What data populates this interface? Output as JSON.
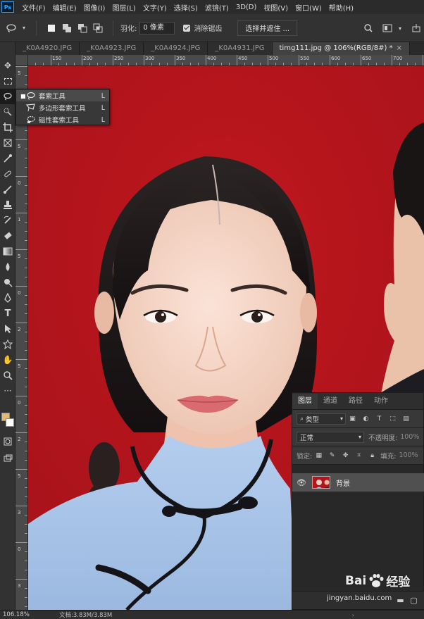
{
  "app": {
    "logo_text": "Ps"
  },
  "menubar": {
    "items": [
      "文件(F)",
      "编辑(E)",
      "图像(I)",
      "图层(L)",
      "文字(Y)",
      "选择(S)",
      "滤镜(T)",
      "3D(D)",
      "视图(V)",
      "窗口(W)",
      "帮助(H)"
    ]
  },
  "options": {
    "feather_label": "羽化:",
    "feather_value": "0 像素",
    "antialias_label": "消除锯齿",
    "select_mask_label": "选择并遮住 ..."
  },
  "tabs": [
    {
      "label": "_K0A4920.JPG",
      "active": false
    },
    {
      "label": "_K0A4923.JPG",
      "active": false
    },
    {
      "label": "_K0A4924.JPG",
      "active": false
    },
    {
      "label": "_K0A4931.JPG",
      "active": false
    },
    {
      "label": "timg111.jpg @ 106%(RGB/8#) *",
      "active": true
    }
  ],
  "ruler": {
    "h_labels": [
      "150",
      "200",
      "250",
      "300",
      "350",
      "400",
      "450",
      "500",
      "550",
      "600",
      "650",
      "700",
      "750"
    ],
    "v_labels": [
      "5",
      "0",
      "5",
      "0",
      "1",
      "5",
      "0",
      "2",
      "5",
      "0",
      "2",
      "5",
      "3",
      "0",
      "3"
    ]
  },
  "flyout": {
    "items": [
      {
        "label": "套索工具",
        "key": "L",
        "selected": true
      },
      {
        "label": "多边形套索工具",
        "key": "L",
        "selected": false
      },
      {
        "label": "磁性套索工具",
        "key": "L",
        "selected": false
      }
    ]
  },
  "layers_panel": {
    "tabs": [
      "图层",
      "通道",
      "路径",
      "动作"
    ],
    "filter_kind": "类型",
    "blend_mode": "正常",
    "opacity_label": "不透明度:",
    "opacity_value": "100%",
    "lock_label": "锁定:",
    "fill_label": "填充:",
    "fill_value": "100%",
    "layer_name": "背景"
  },
  "statusbar": {
    "zoom": "106.18%",
    "doc_info": "文档:3.83M/3.83M"
  },
  "watermark": {
    "brand_left": "Bai",
    "brand_right": "经验",
    "url": "jingyan.baidu.com"
  },
  "colors": {
    "backdrop_red": "#b4141b",
    "foreground_swatch": "#e8b96a",
    "background_swatch": "#ffffff",
    "qipao_blue": "#a9c4e6"
  }
}
